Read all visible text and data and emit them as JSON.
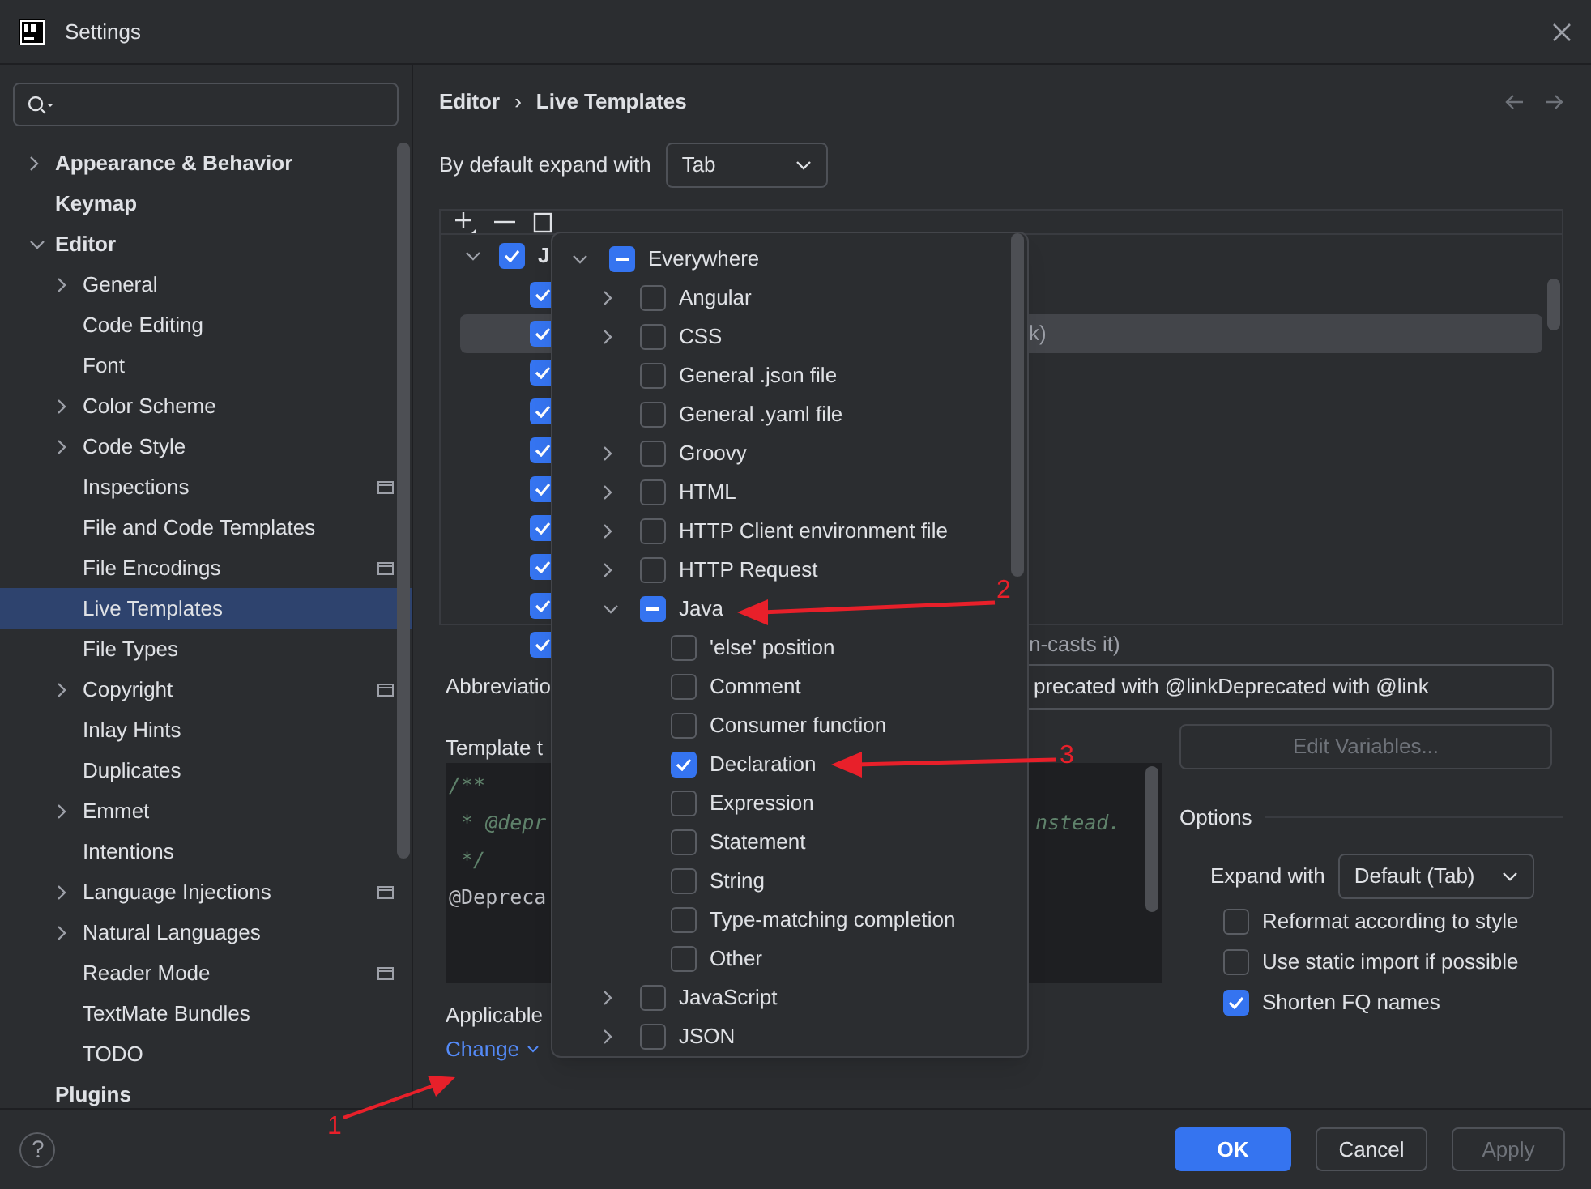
{
  "window": {
    "title": "Settings"
  },
  "sidebar": {
    "items": [
      {
        "label": "Appearance & Behavior",
        "expanded": false,
        "selected": false
      },
      {
        "label": "Keymap",
        "selected": false
      },
      {
        "label": "Editor",
        "expanded": true,
        "selected": false,
        "children": [
          {
            "label": "General",
            "expanded": false,
            "selected": false,
            "project": false
          },
          {
            "label": "Code Editing",
            "selected": false,
            "project": false
          },
          {
            "label": "Font",
            "selected": false,
            "project": false
          },
          {
            "label": "Color Scheme",
            "expanded": false,
            "selected": false,
            "project": false
          },
          {
            "label": "Code Style",
            "expanded": false,
            "selected": false,
            "project": false
          },
          {
            "label": "Inspections",
            "selected": false,
            "project": true
          },
          {
            "label": "File and Code Templates",
            "selected": false,
            "project": false
          },
          {
            "label": "File Encodings",
            "selected": false,
            "project": true
          },
          {
            "label": "Live Templates",
            "selected": true,
            "project": false
          },
          {
            "label": "File Types",
            "selected": false,
            "project": false
          },
          {
            "label": "Copyright",
            "expanded": false,
            "selected": false,
            "project": true
          },
          {
            "label": "Inlay Hints",
            "selected": false,
            "project": false
          },
          {
            "label": "Duplicates",
            "selected": false,
            "project": false
          },
          {
            "label": "Emmet",
            "expanded": false,
            "selected": false,
            "project": false
          },
          {
            "label": "Intentions",
            "selected": false,
            "project": false
          },
          {
            "label": "Language Injections",
            "expanded": false,
            "selected": false,
            "project": true
          },
          {
            "label": "Natural Languages",
            "expanded": false,
            "selected": false,
            "project": false
          },
          {
            "label": "Reader Mode",
            "selected": false,
            "project": true
          },
          {
            "label": "TextMate Bundles",
            "selected": false,
            "project": false
          },
          {
            "label": "TODO",
            "selected": false,
            "project": false
          }
        ]
      },
      {
        "label": "Plugins",
        "selected": false
      }
    ]
  },
  "breadcrumb": [
    "Editor",
    "›",
    "Live Templates"
  ],
  "expand_default": {
    "label": "By default expand with",
    "value": "Tab"
  },
  "templates": {
    "group": {
      "label": "J",
      "checked": true,
      "expanded": true
    },
    "rows": [
      {
        "checked": true,
        "selected": false
      },
      {
        "checked": true,
        "selected": true,
        "text": "k)"
      },
      {
        "checked": true,
        "selected": false
      },
      {
        "checked": true,
        "selected": false
      },
      {
        "checked": true,
        "selected": false
      },
      {
        "checked": true,
        "selected": false
      },
      {
        "checked": true,
        "selected": false
      },
      {
        "checked": true,
        "selected": false
      },
      {
        "checked": true,
        "selected": false
      },
      {
        "checked": true,
        "selected": false,
        "text": "n-casts it)"
      }
    ]
  },
  "abbreviation": {
    "label": "Abbreviatio",
    "description": "precated with @linkDeprecated with @link"
  },
  "template_text": {
    "label": "Template t",
    "lines": [
      {
        "kind": "comment",
        "text": "/**"
      },
      {
        "kind": "comment",
        "text": " * @depr",
        "tail": "nstead."
      },
      {
        "kind": "comment",
        "text": " */"
      },
      {
        "kind": "code",
        "text": "@Depreca"
      }
    ]
  },
  "applicable": {
    "label": "Applicable",
    "link": "Change"
  },
  "edit_variables": {
    "label": "Edit Variables...",
    "disabled": true
  },
  "options": {
    "title": "Options",
    "expand_label": "Expand with",
    "expand_value": "Default (Tab)",
    "checks": [
      {
        "label": "Reformat according to style",
        "checked": false
      },
      {
        "label": "Use static import if possible",
        "checked": false
      },
      {
        "label": "Shorten FQ names",
        "checked": true
      }
    ]
  },
  "contexts": [
    {
      "label": "Everywhere",
      "mixed": true,
      "expanded": true,
      "children": [
        {
          "label": "Angular",
          "checked": false,
          "mixed": false,
          "expanded": false
        },
        {
          "label": "CSS",
          "checked": false,
          "mixed": false,
          "expanded": false
        },
        {
          "label": "General .json file",
          "checked": false,
          "mixed": false
        },
        {
          "label": "General .yaml file",
          "checked": false,
          "mixed": false
        },
        {
          "label": "Groovy",
          "checked": false,
          "mixed": false,
          "expanded": false
        },
        {
          "label": "HTML",
          "checked": false,
          "mixed": false,
          "expanded": false
        },
        {
          "label": "HTTP Client environment file",
          "checked": false,
          "mixed": false,
          "expanded": false
        },
        {
          "label": "HTTP Request",
          "checked": false,
          "mixed": false,
          "expanded": false
        },
        {
          "label": "Java",
          "mixed": true,
          "expanded": true,
          "children": [
            {
              "label": "'else' position",
              "checked": false,
              "mixed": false
            },
            {
              "label": "Comment",
              "checked": false,
              "mixed": false
            },
            {
              "label": "Consumer function",
              "checked": false,
              "mixed": false
            },
            {
              "label": "Declaration",
              "checked": true
            },
            {
              "label": "Expression",
              "checked": false,
              "mixed": false
            },
            {
              "label": "Statement",
              "checked": false,
              "mixed": false
            },
            {
              "label": "String",
              "checked": false,
              "mixed": false
            },
            {
              "label": "Type-matching completion",
              "checked": false,
              "mixed": false
            },
            {
              "label": "Other",
              "checked": false,
              "mixed": false
            }
          ]
        },
        {
          "label": "JavaScript",
          "checked": false,
          "mixed": false,
          "expanded": false
        },
        {
          "label": "JSON",
          "checked": false,
          "mixed": false,
          "expanded": false
        }
      ]
    }
  ],
  "annotations": [
    {
      "label": "1"
    },
    {
      "label": "2"
    },
    {
      "label": "3"
    }
  ],
  "buttons": [
    {
      "label": "OK",
      "kind": "primary",
      "disabled": false
    },
    {
      "label": "Cancel",
      "kind": "normal",
      "disabled": false
    },
    {
      "label": "Apply",
      "kind": "normal",
      "disabled": true
    }
  ]
}
